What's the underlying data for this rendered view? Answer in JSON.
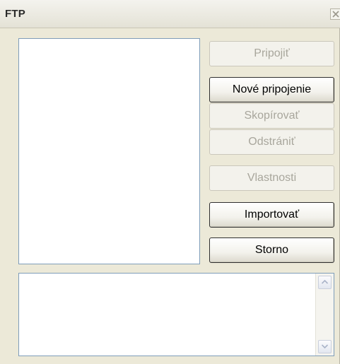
{
  "window": {
    "title": "FTP"
  },
  "buttons": {
    "connect": {
      "label": "Pripojiť",
      "enabled": false
    },
    "new_connection": {
      "label": "Nové pripojenie",
      "enabled": true
    },
    "copy": {
      "label": "Skopírovať",
      "enabled": false
    },
    "delete": {
      "label": "Odstrániť",
      "enabled": false
    },
    "properties": {
      "label": "Vlastnosti",
      "enabled": false
    },
    "import": {
      "label": "Importovať",
      "enabled": true
    },
    "cancel": {
      "label": "Storno",
      "enabled": true
    }
  },
  "connections_list": {
    "items": []
  },
  "log": {
    "text": ""
  },
  "icons": {
    "close": "close-icon",
    "scroll_up": "scroll-up-arrow-icon",
    "scroll_down": "scroll-down-arrow-icon"
  },
  "colors": {
    "window_bg": "#ece9d8",
    "field_border": "#7f9db9",
    "disabled_text": "#a8a69c"
  }
}
